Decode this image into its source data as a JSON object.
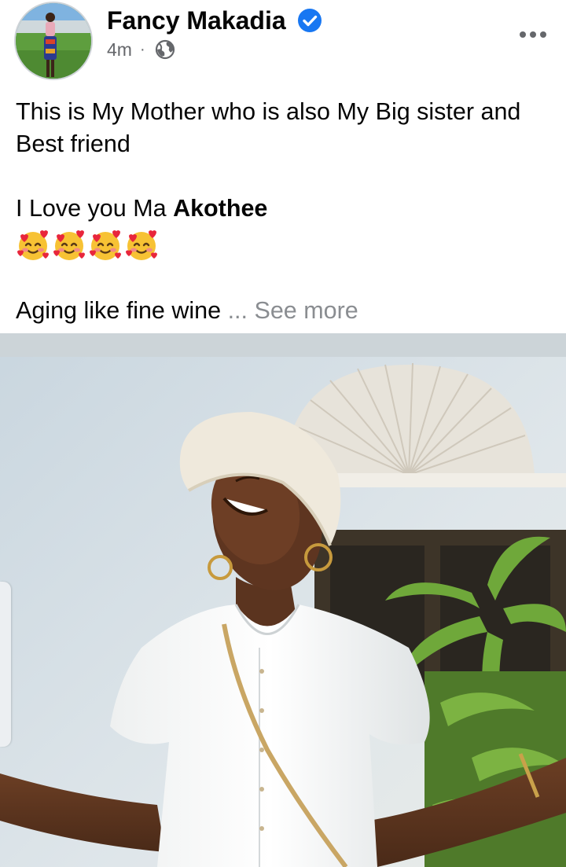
{
  "post": {
    "author": {
      "name": "Fancy Makadia",
      "verified": true,
      "avatar_icon": "profile-photo"
    },
    "timestamp": "4m",
    "separator": "·",
    "audience_icon": "globe-icon",
    "more_icon": "more-options-icon",
    "caption": {
      "line1": "This is My Mother who is also My Big sister and Best friend",
      "love_prefix": "I Love you Ma ",
      "love_name": "Akothee",
      "emoji_name": "smiling-face-with-hearts",
      "emoji_count": 4,
      "aging_text": "Aging like fine wine",
      "ellipsis": " ... ",
      "see_more": "See more"
    },
    "colors": {
      "verified_blue": "#1877f2",
      "secondary_text": "#65676b",
      "see_more_text": "#8a8d91"
    }
  }
}
